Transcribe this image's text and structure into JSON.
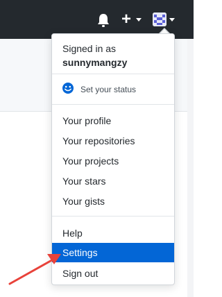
{
  "header": {
    "notification_icon": "bell-icon",
    "create_icon": "plus-icon",
    "plus_glyph": "+",
    "avatar_icon": "avatar"
  },
  "dropdown": {
    "signed_in_label": "Signed in as",
    "username": "sunnymangzy",
    "status_label": "Set your status",
    "items": [
      {
        "label": "Your profile"
      },
      {
        "label": "Your repositories"
      },
      {
        "label": "Your projects"
      },
      {
        "label": "Your stars"
      },
      {
        "label": "Your gists"
      },
      {
        "label": "Help"
      },
      {
        "label": "Settings",
        "active": true
      },
      {
        "label": "Sign out"
      }
    ]
  },
  "colors": {
    "header_bg": "#24292e",
    "active_bg": "#0366d6",
    "annotation_arrow": "#e8423a"
  }
}
